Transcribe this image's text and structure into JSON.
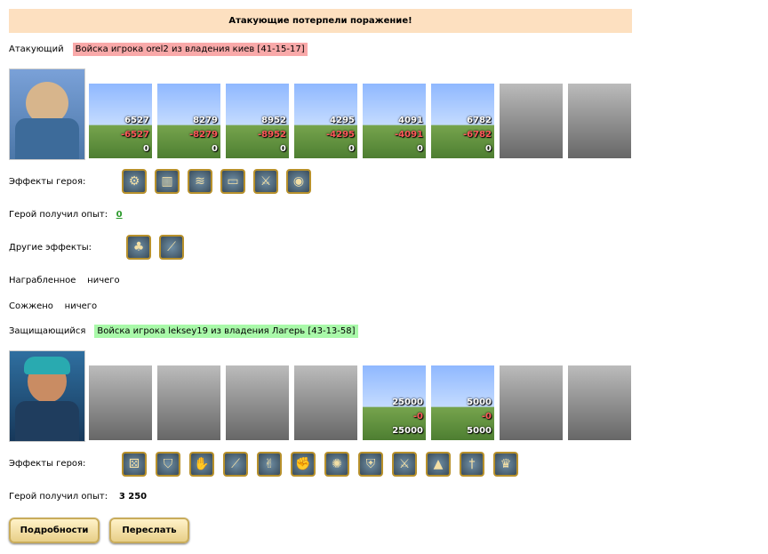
{
  "banner": "Атакующие потерпели поражение!",
  "attacker": {
    "label": "Атакующий",
    "army": "Войска игрока orel2 из владения киев [41-15-17]",
    "units": [
      {
        "count": "6527",
        "lost": "-6527",
        "remain": "0"
      },
      {
        "count": "8279",
        "lost": "-8279",
        "remain": "0"
      },
      {
        "count": "8952",
        "lost": "-8952",
        "remain": "0"
      },
      {
        "count": "4295",
        "lost": "-4295",
        "remain": "0"
      },
      {
        "count": "4091",
        "lost": "-4091",
        "remain": "0"
      },
      {
        "count": "6782",
        "lost": "-6782",
        "remain": "0"
      }
    ],
    "effects_label": "Эффекты героя:",
    "exp_label": "Герой получил опыт:",
    "exp_value": "0",
    "other_label": "Другие эффекты:",
    "loot_label": "Награбленное",
    "loot_value": "ничего",
    "burned_label": "Сожжено",
    "burned_value": "ничего"
  },
  "defender": {
    "label": "Защищающийся",
    "army": "Войска игрока leksey19 из владения Лагерь [43-13-58]",
    "units": [
      {
        "count": "25000",
        "lost": "-0",
        "remain": "25000"
      },
      {
        "count": "5000",
        "lost": "-0",
        "remain": "5000"
      }
    ],
    "effects_label": "Эффекты героя:",
    "exp_label": "Герой получил опыт:",
    "exp_value": "3 250"
  },
  "buttons": {
    "details": "Подробности",
    "forward": "Переслать"
  },
  "colors": {
    "banner_bg": "#fde0c0",
    "attacker_tag": "#f9a9a9",
    "defender_tag": "#a9f9a9",
    "link": "#2c9a2c"
  }
}
